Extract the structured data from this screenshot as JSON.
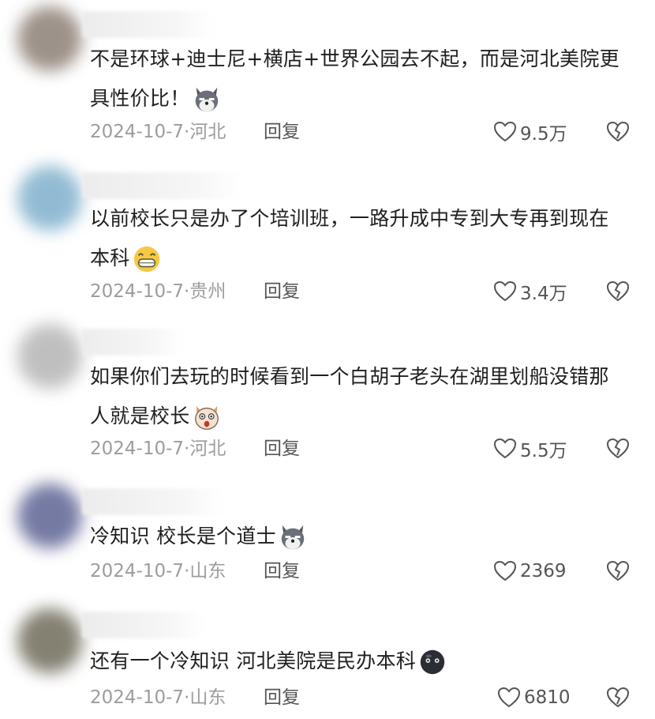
{
  "comments": [
    {
      "text": "不是环球+迪士尼+横店+世界公园去不起，而是河北美院更具性价比！",
      "emoji": "wolf-icon",
      "date": "2024-10-7·",
      "location": "河北",
      "reply": "回复",
      "likes": "9.5万"
    },
    {
      "text": "以前校长只是办了个培训班，一路升成中专到大专再到现在本科",
      "emoji": "grin-icon",
      "date": "2024-10-7·",
      "location": "贵州",
      "reply": "回复",
      "likes": "3.4万"
    },
    {
      "text": "如果你们去玩的时候看到一个白胡子老头在湖里划船没错那人就是校长",
      "emoji": "shocked-cat-icon",
      "date": "2024-10-7·",
      "location": "河北",
      "reply": "回复",
      "likes": "5.5万"
    },
    {
      "text": "冷知识 校长是个道士",
      "emoji": "wolf-icon",
      "date": "2024-10-7·",
      "location": "山东",
      "reply": "回复",
      "likes": "2369"
    },
    {
      "text": "还有一个冷知识 河北美院是民办本科",
      "emoji": "dark-ball-icon",
      "date": "2024-10-7·",
      "location": "山东",
      "reply": "回复",
      "likes": "6810"
    }
  ]
}
